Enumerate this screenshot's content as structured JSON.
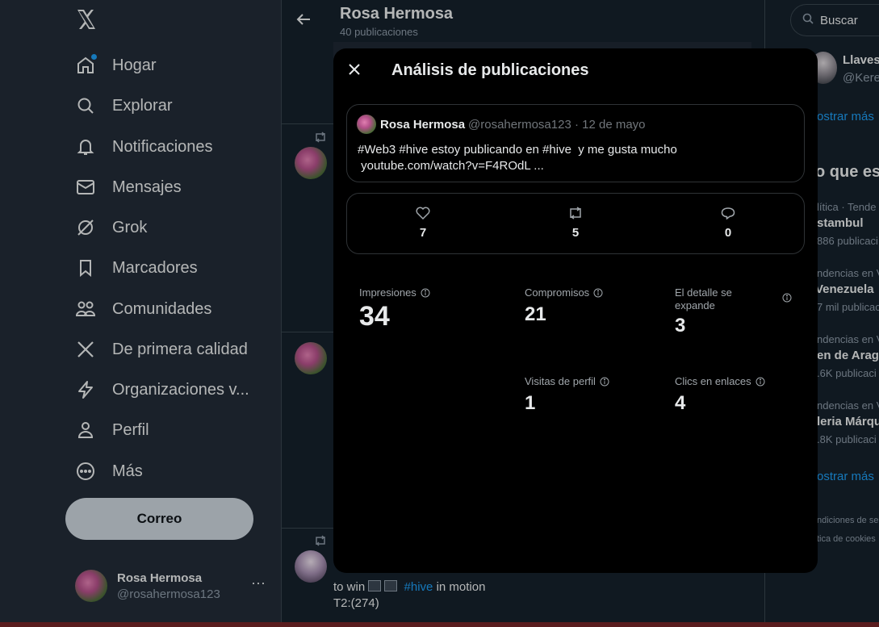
{
  "sidebar": {
    "logo_icon": "x-logo-icon",
    "items": [
      {
        "label": "Hogar",
        "icon": "home-icon",
        "has_dot": true
      },
      {
        "label": "Explorar",
        "icon": "search-icon"
      },
      {
        "label": "Notificaciones",
        "icon": "bell-icon"
      },
      {
        "label": "Mensajes",
        "icon": "mail-icon"
      },
      {
        "label": "Grok",
        "icon": "grok-icon"
      },
      {
        "label": "Marcadores",
        "icon": "bookmark-icon"
      },
      {
        "label": "Comunidades",
        "icon": "communities-icon"
      },
      {
        "label": "De primera calidad",
        "icon": "x-premium-icon"
      },
      {
        "label": "Organizaciones v...",
        "icon": "lightning-icon"
      },
      {
        "label": "Perfil",
        "icon": "person-icon"
      },
      {
        "label": "Más",
        "icon": "more-circle-icon"
      }
    ],
    "post_button": "Correo",
    "account": {
      "name": "Rosa Hermosa",
      "handle": "@rosahermosa123",
      "more": "···"
    }
  },
  "profile": {
    "title": "Rosa Hermosa",
    "subtitle": "40 publicaciones"
  },
  "feed": {
    "visible_text": {
      "part1": "to win",
      "hashtag": "#hive",
      "part2": "in motion",
      "line2": "T2:(274)"
    }
  },
  "right": {
    "search_placeholder": "Buscar",
    "follow_name": "Llaves",
    "follow_handle": "@Kere",
    "show_more_1": "ostrar más",
    "trends_heading": "o que est",
    "trends": [
      {
        "meta": "lítica · Tende",
        "name": "stambul",
        "count": "886 publicaci"
      },
      {
        "meta": "ndencias en V",
        "name": "Venezuela",
        "count": "7 mil publicac"
      },
      {
        "meta": "ndencias en V",
        "name": "en de Arag",
        "count": ".6K publicaci"
      },
      {
        "meta": "ndencias en V",
        "name": "leria Márqu",
        "count": ".8K publicaci"
      }
    ],
    "show_more_2": "ostrar más",
    "footer_1": "ndiciones de ser",
    "footer_2": "tica de cookies"
  },
  "modal": {
    "title": "Análisis de publicaciones",
    "post": {
      "author": "Rosa Hermosa",
      "meta": "@rosahermosa123 · 12 de mayo",
      "text": "#Web3 #hive estoy publicando en #hive  y me gusta mucho\n youtube.com/watch?v=F4ROdL ..."
    },
    "engagement": {
      "likes": "7",
      "reposts": "5",
      "replies": "0"
    },
    "metrics": {
      "impressions": {
        "label": "Impresiones",
        "value": "34"
      },
      "engagements": {
        "label": "Compromisos",
        "value": "21"
      },
      "detail_expands": {
        "label": "El detalle se expande",
        "value": "3"
      },
      "profile_visits": {
        "label": "Visitas de perfil",
        "value": "1"
      },
      "link_clicks": {
        "label": "Clics en enlaces",
        "value": "4"
      }
    }
  },
  "colors": {
    "accent": "#1d9bf0",
    "background": "#15202b",
    "modal_bg": "#000000"
  }
}
